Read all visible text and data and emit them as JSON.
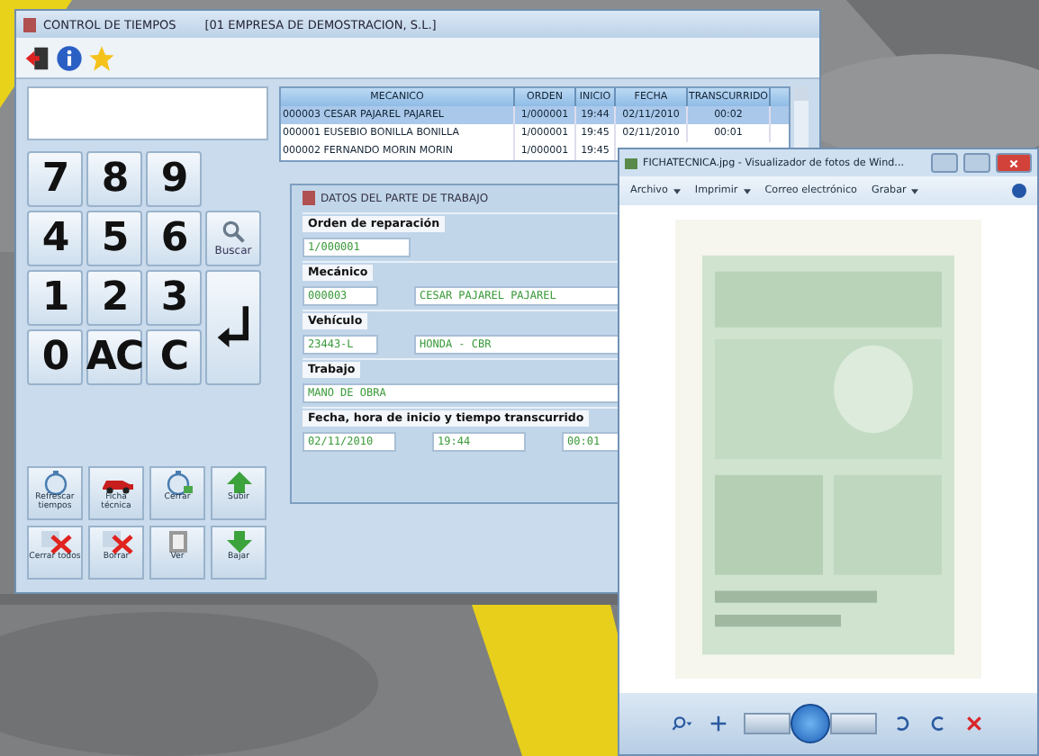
{
  "main_window": {
    "title": "CONTROL DE TIEMPOS",
    "company": "[01  EMPRESA DE DEMOSTRACION, S.L.]"
  },
  "keypad": [
    [
      {
        "kind": "digit",
        "label": "7"
      },
      {
        "kind": "digit",
        "label": "8"
      },
      {
        "kind": "digit",
        "label": "9"
      }
    ],
    [
      {
        "kind": "digit",
        "label": "4"
      },
      {
        "kind": "digit",
        "label": "5"
      },
      {
        "kind": "digit",
        "label": "6"
      },
      {
        "kind": "search",
        "label": "Buscar"
      }
    ],
    [
      {
        "kind": "digit",
        "label": "1"
      },
      {
        "kind": "digit",
        "label": "2"
      },
      {
        "kind": "digit",
        "label": "3"
      },
      {
        "kind": "enter"
      }
    ],
    [
      {
        "kind": "digit",
        "label": "0"
      },
      {
        "kind": "digit",
        "label": "AC"
      },
      {
        "kind": "digit",
        "label": "C"
      }
    ]
  ],
  "actions": [
    {
      "kind": "refresh",
      "label": "Refrescar tiempos"
    },
    {
      "kind": "car",
      "label": "Ficha técnica"
    },
    {
      "kind": "close",
      "label": "Cerrar"
    },
    {
      "kind": "up",
      "label": "Subir"
    },
    {
      "kind": "close_all",
      "label": "Cerrar todos"
    },
    {
      "kind": "delete",
      "label": "Borrar"
    },
    {
      "kind": "view",
      "label": "Ver"
    },
    {
      "kind": "down",
      "label": "Bajar"
    }
  ],
  "table": {
    "columns": [
      "MECANICO",
      "ORDEN",
      "INICIO",
      "FECHA",
      "TRANSCURRIDO"
    ],
    "rows": [
      {
        "selected": true,
        "cells": [
          "000003 CESAR PAJAREL PAJAREL",
          "1/000001",
          "19:44",
          "02/11/2010",
          "00:02"
        ]
      },
      {
        "selected": false,
        "cells": [
          "000001 EUSEBIO BONILLA BONILLA",
          "1/000001",
          "19:45",
          "02/11/2010",
          "00:01"
        ]
      },
      {
        "selected": false,
        "cells": [
          "000002 FERNANDO MORIN MORIN",
          "1/000001",
          "19:45"
        ]
      }
    ]
  },
  "work_panel": {
    "title": "DATOS DEL PARTE DE TRABAJO",
    "sections": [
      {
        "label": "Orden de reparación",
        "fields": [
          "1/000001"
        ]
      },
      {
        "label": "Mecánico",
        "fields": [
          "000003",
          "CESAR  PAJAREL  PAJAREL"
        ]
      },
      {
        "label": "Vehículo",
        "fields": [
          "23443-L",
          "HONDA  -  CBR"
        ]
      },
      {
        "label": "Trabajo",
        "fields": [
          "MANO DE OBRA"
        ]
      },
      {
        "label": "Fecha, hora de inicio y tiempo transcurrido",
        "fields": [
          "02/11/2010",
          "19:44",
          "00:01"
        ]
      }
    ]
  },
  "viewer": {
    "title": "FICHATECNICA.jpg - Visualizador de fotos de Wind...",
    "menu": [
      {
        "label": "Archivo",
        "dropdown": true
      },
      {
        "label": "Imprimir",
        "dropdown": true
      },
      {
        "label": "Correo electrónico",
        "dropdown": false
      },
      {
        "label": "Grabar",
        "dropdown": true
      }
    ]
  }
}
